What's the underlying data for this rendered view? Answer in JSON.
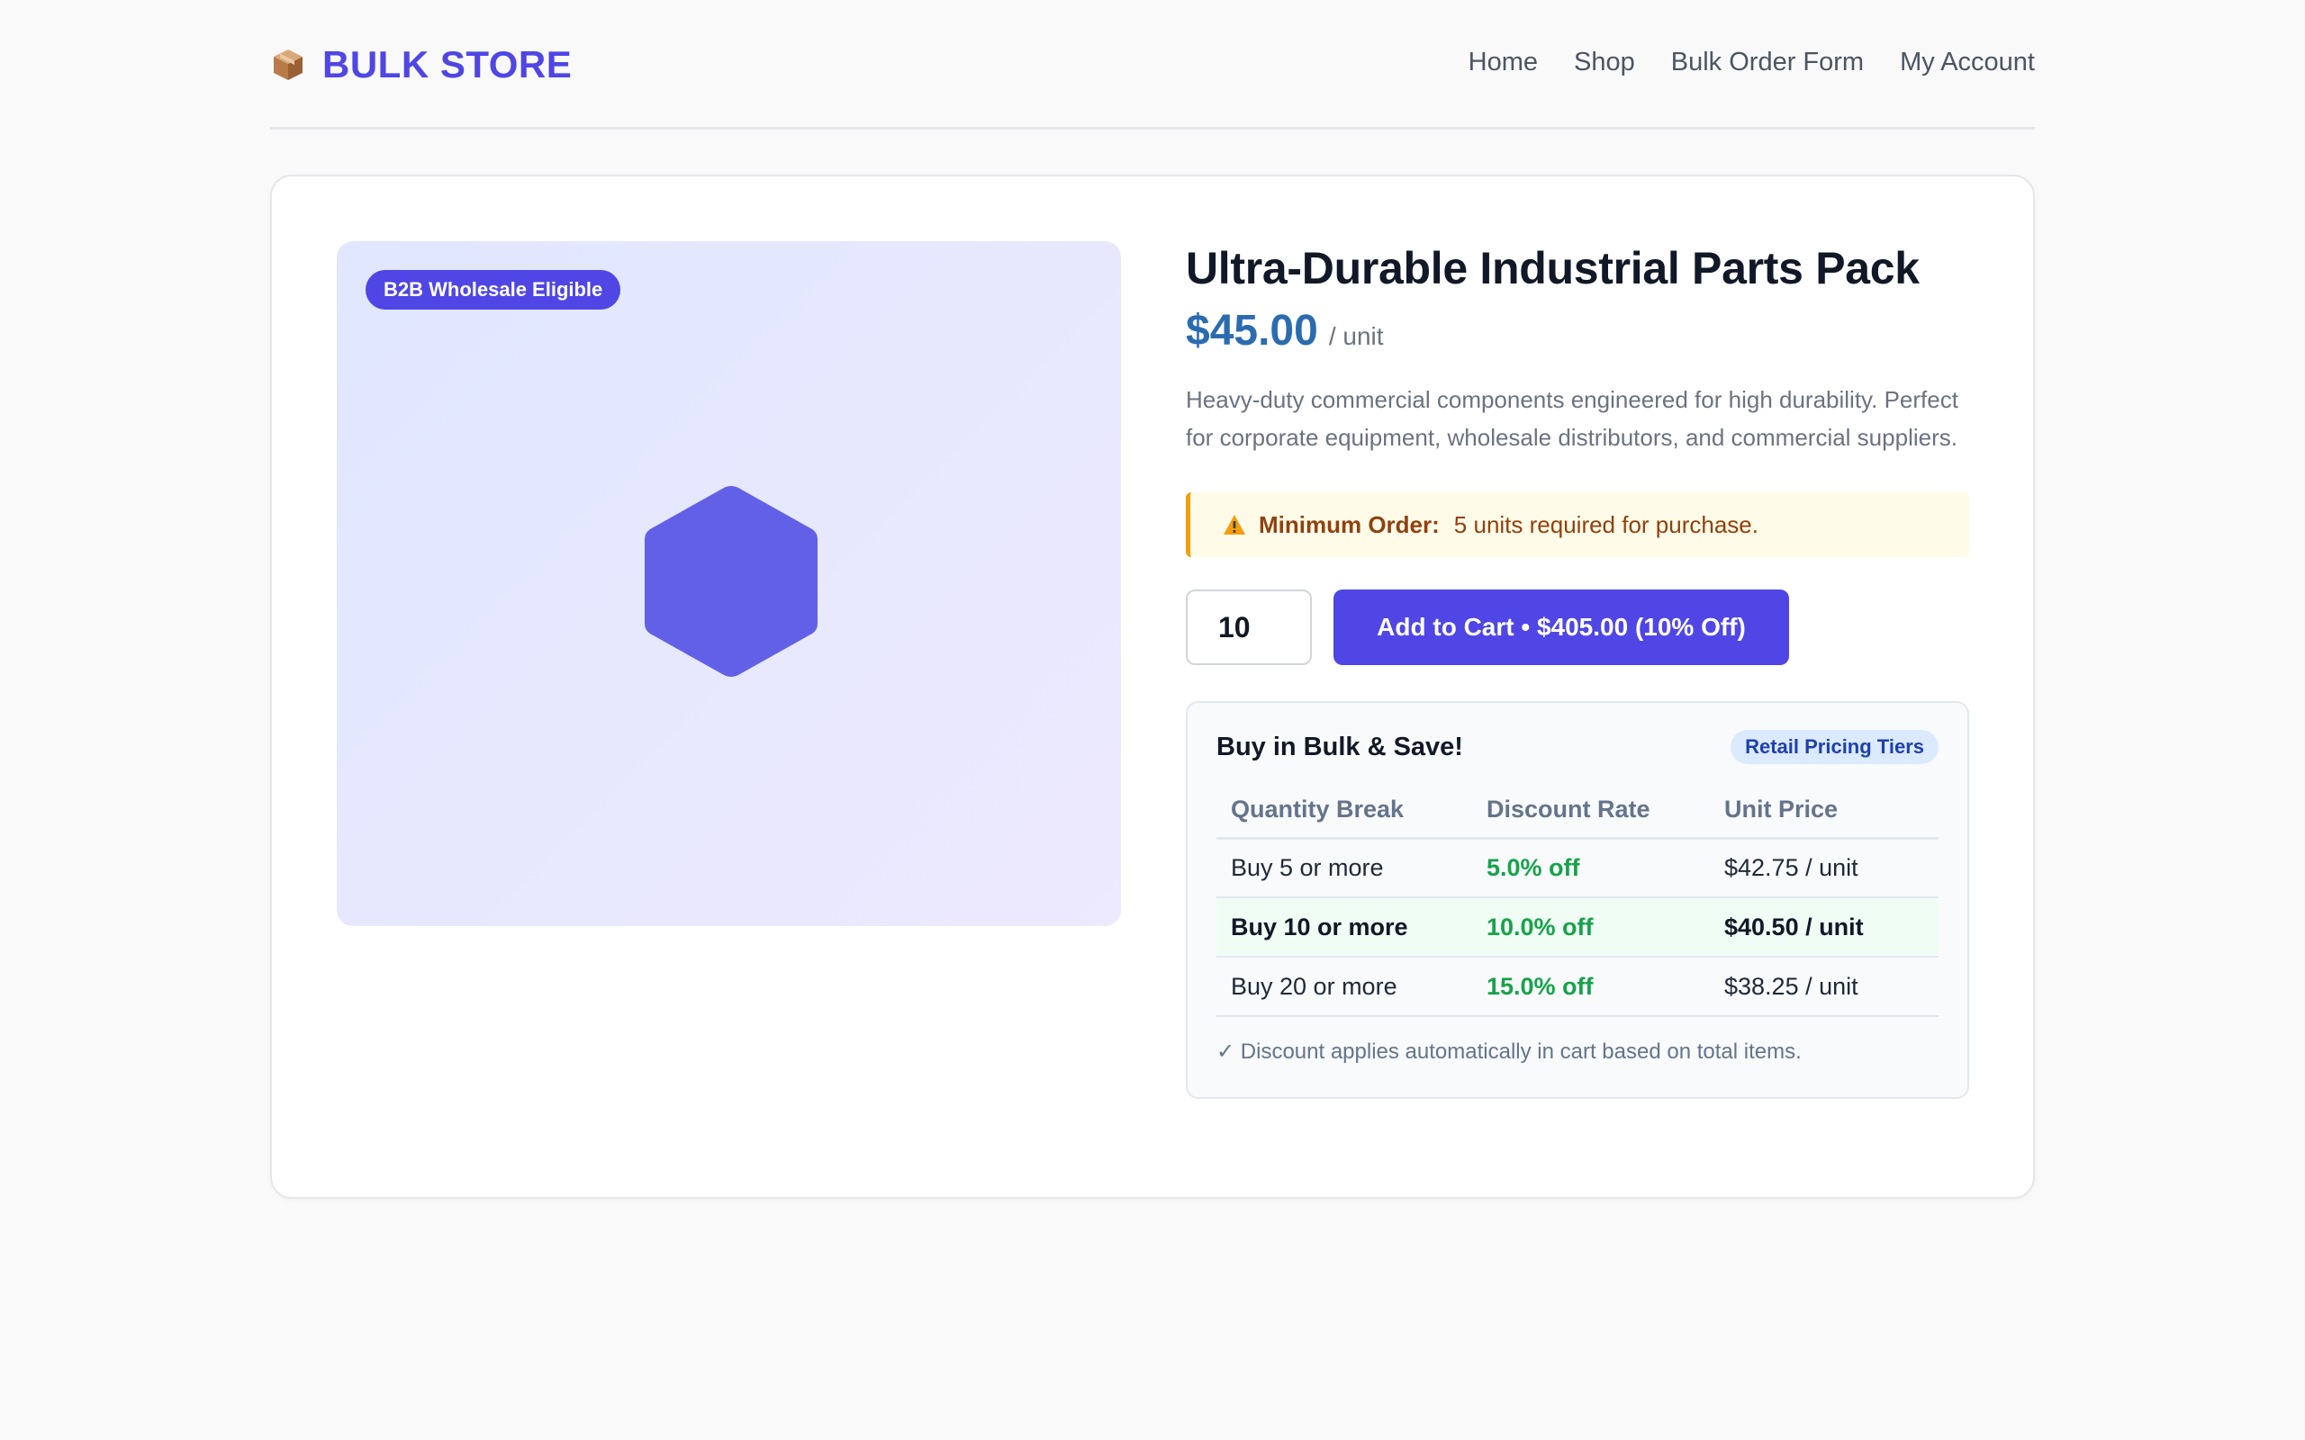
{
  "header": {
    "brand_icon": "package-icon",
    "brand_name": "BULK STORE",
    "nav": [
      "Home",
      "Shop",
      "Bulk Order Form",
      "My Account"
    ]
  },
  "product": {
    "badge": "B2B Wholesale Eligible",
    "image_icon": "hexagon-icon",
    "title": "Ultra-Durable Industrial Parts Pack",
    "price": "$45.00",
    "price_unit": "/ unit",
    "description": "Heavy-duty commercial components engineered for high durability. Perfect for corporate equipment, wholesale distributors, and commercial suppliers.",
    "min_order": {
      "icon": "warning-icon",
      "label": "Minimum Order:",
      "text": "5 units required for purchase."
    },
    "quantity": "10",
    "add_to_cart_label": "Add to Cart • $405.00 (10% Off)"
  },
  "bulk": {
    "title": "Buy in Bulk & Save!",
    "badge": "Retail Pricing Tiers",
    "headers": [
      "Quantity Break",
      "Discount Rate",
      "Unit Price"
    ],
    "rows": [
      {
        "qty": "Buy 5 or more",
        "rate": "5.0% off",
        "price": "$42.75 / unit",
        "active": false
      },
      {
        "qty": "Buy 10 or more",
        "rate": "10.0% off",
        "price": "$40.50 / unit",
        "active": true
      },
      {
        "qty": "Buy 20 or more",
        "rate": "15.0% off",
        "price": "$38.25 / unit",
        "active": false
      }
    ],
    "note": "✓ Discount applies automatically in cart based on total items."
  },
  "colors": {
    "brand": "#4f46e5",
    "price": "#2b6cb0",
    "discount": "#16a34a",
    "warning_border": "#f59e0b",
    "warning_bg": "#fefce8"
  }
}
